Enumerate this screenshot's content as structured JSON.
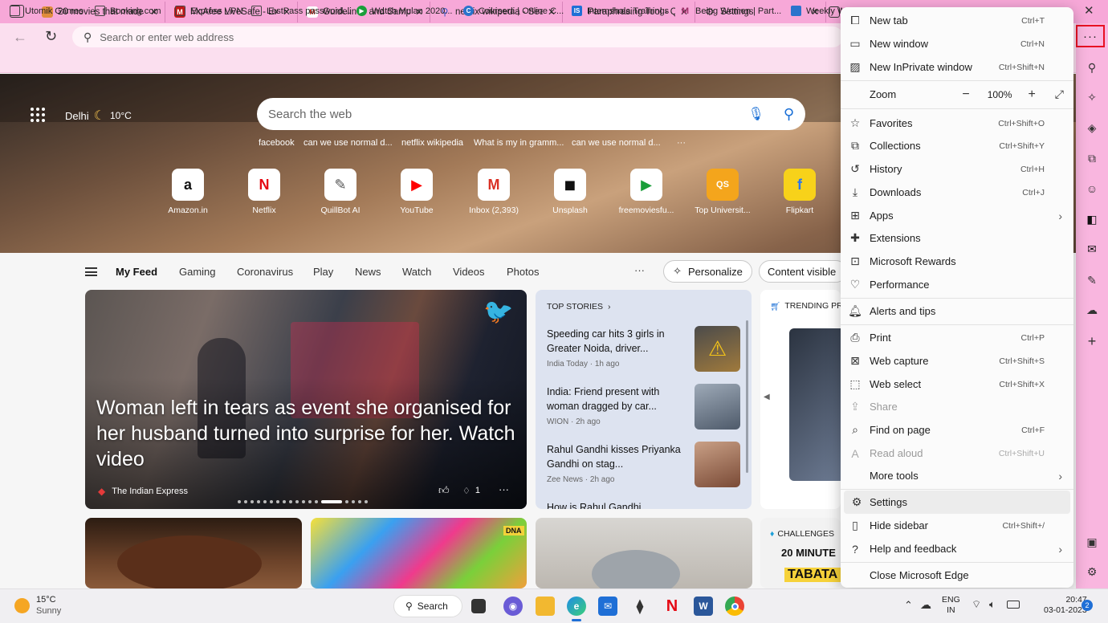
{
  "tabs": [
    {
      "title": "20 movies that made c"
    },
    {
      "title": "McAfee LiveSafe - Exp"
    },
    {
      "title": "Guidelines and Sampl"
    },
    {
      "title": "netflix wikipedia - Sea"
    },
    {
      "title": "Paraphrasing Tool - Q"
    },
    {
      "title": "Settings"
    }
  ],
  "address": {
    "placeholder": "Search or enter web address"
  },
  "bookmarks": [
    "Utomik Games",
    "Booking.com",
    "Express VPN",
    "LastPass password...",
    "Watch Mulan 2020...",
    "Coursera | Online C...",
    "Internshala Trainings",
    "Being Women | Part...",
    "Weekly W"
  ],
  "hero": {
    "city": "Delhi",
    "temp": "10°C",
    "search_placeholder": "Search the web",
    "trending": [
      "facebook",
      "can we use normal d...",
      "netflix wikipedia",
      "What is my in gramm...",
      "can we use normal d...",
      "···"
    ],
    "quick_sites": [
      {
        "label": "Amazon.in",
        "glyph": "a",
        "color": "#111111"
      },
      {
        "label": "Netflix",
        "glyph": "N",
        "color": "#e50914"
      },
      {
        "label": "QuillBot AI",
        "glyph": "✎",
        "color": "#555555"
      },
      {
        "label": "YouTube",
        "glyph": "▶",
        "color": "#ff0000"
      },
      {
        "label": "Inbox (2,393)",
        "glyph": "M",
        "color": "#d93025"
      },
      {
        "label": "Unsplash",
        "glyph": "◼",
        "color": "#111111"
      },
      {
        "label": "freemoviesfu...",
        "glyph": "▶",
        "color": "#1a9e3a"
      },
      {
        "label": "Top Universit...",
        "glyph": "QS",
        "color": "#ffffff"
      },
      {
        "label": "Flipkart",
        "glyph": "f",
        "color": "#2874f0"
      }
    ]
  },
  "feed_nav": {
    "items": [
      "My Feed",
      "Gaming",
      "Coronavirus",
      "Play",
      "News",
      "Watch",
      "Videos",
      "Photos"
    ],
    "more": "···",
    "personalize": "Personalize",
    "content_visible": "Content visible"
  },
  "hero_card": {
    "headline": "Woman left in tears as event she organised for her husband turned into surprise for her. Watch video",
    "source": "The Indian Express",
    "dislike_count": "1"
  },
  "top_stories": {
    "title": "TOP STORIES",
    "items": [
      {
        "headline": "Speeding car hits 3 girls in Greater Noida, driver...",
        "meta": "India Today · 1h ago"
      },
      {
        "headline": "India: Friend present with woman dragged by car...",
        "meta": "WION · 2h ago"
      },
      {
        "headline": "Rahul Gandhi kisses Priyanka Gandhi on stag...",
        "meta": "Zee News · 2h ago"
      },
      {
        "headline": "How is Rahul Gandhi",
        "meta": ""
      }
    ]
  },
  "trending_card": {
    "title": "TRENDING PR"
  },
  "challenges_card": {
    "title": "CHALLENGES",
    "text1": "20 MINUTE",
    "text2": "TABATA"
  },
  "dna_label": "DNA",
  "menu": {
    "zoom_label": "Zoom",
    "zoom_value": "100%",
    "items": [
      {
        "id": "new-tab",
        "label": "New tab",
        "shortcut": "Ctrl+T",
        "icon": "new-tab-icon"
      },
      {
        "id": "new-window",
        "label": "New window",
        "shortcut": "Ctrl+N",
        "icon": "new-window-icon"
      },
      {
        "id": "new-inprivate",
        "label": "New InPrivate window",
        "shortcut": "Ctrl+Shift+N",
        "icon": "inprivate-icon"
      },
      {
        "id": "favorites",
        "label": "Favorites",
        "shortcut": "Ctrl+Shift+O",
        "icon": "star-icon"
      },
      {
        "id": "collections",
        "label": "Collections",
        "shortcut": "Ctrl+Shift+Y",
        "icon": "collections-icon"
      },
      {
        "id": "history",
        "label": "History",
        "shortcut": "Ctrl+H",
        "icon": "history-icon"
      },
      {
        "id": "downloads",
        "label": "Downloads",
        "shortcut": "Ctrl+J",
        "icon": "download-icon"
      },
      {
        "id": "apps",
        "label": "Apps",
        "shortcut": "",
        "icon": "apps-icon"
      },
      {
        "id": "extensions",
        "label": "Extensions",
        "shortcut": "",
        "icon": "puzzle-icon"
      },
      {
        "id": "rewards",
        "label": "Microsoft Rewards",
        "shortcut": "",
        "icon": "rewards-icon"
      },
      {
        "id": "performance",
        "label": "Performance",
        "shortcut": "",
        "icon": "heartbeat-icon"
      },
      {
        "id": "alerts",
        "label": "Alerts and tips",
        "shortcut": "",
        "icon": "bell-icon"
      },
      {
        "id": "print",
        "label": "Print",
        "shortcut": "Ctrl+P",
        "icon": "printer-icon"
      },
      {
        "id": "web-capture",
        "label": "Web capture",
        "shortcut": "Ctrl+Shift+S",
        "icon": "capture-icon"
      },
      {
        "id": "web-select",
        "label": "Web select",
        "shortcut": "Ctrl+Shift+X",
        "icon": "select-icon"
      },
      {
        "id": "share",
        "label": "Share",
        "shortcut": "",
        "icon": "share-icon"
      },
      {
        "id": "find",
        "label": "Find on page",
        "shortcut": "Ctrl+F",
        "icon": "find-icon"
      },
      {
        "id": "read-aloud",
        "label": "Read aloud",
        "shortcut": "Ctrl+Shift+U",
        "icon": "read-aloud-icon"
      },
      {
        "id": "more-tools",
        "label": "More tools",
        "shortcut": "",
        "icon": ""
      },
      {
        "id": "settings",
        "label": "Settings",
        "shortcut": "",
        "icon": "gear-icon"
      },
      {
        "id": "hide-sidebar",
        "label": "Hide sidebar",
        "shortcut": "Ctrl+Shift+/",
        "icon": "sidebar-icon"
      },
      {
        "id": "help",
        "label": "Help and feedback",
        "shortcut": "",
        "icon": "help-icon"
      },
      {
        "id": "close",
        "label": "Close Microsoft Edge",
        "shortcut": "",
        "icon": ""
      }
    ]
  },
  "taskbar": {
    "weather_temp": "15°C",
    "weather_desc": "Sunny",
    "search_label": "Search",
    "lang1": "ENG",
    "lang2": "IN",
    "time": "20:47",
    "date": "03-01-2023",
    "notif_count": "2"
  },
  "colors": {
    "tabbar": "#f7a8d8",
    "sidebar": "#f9b6df",
    "menu_highlight": "#e81123"
  }
}
